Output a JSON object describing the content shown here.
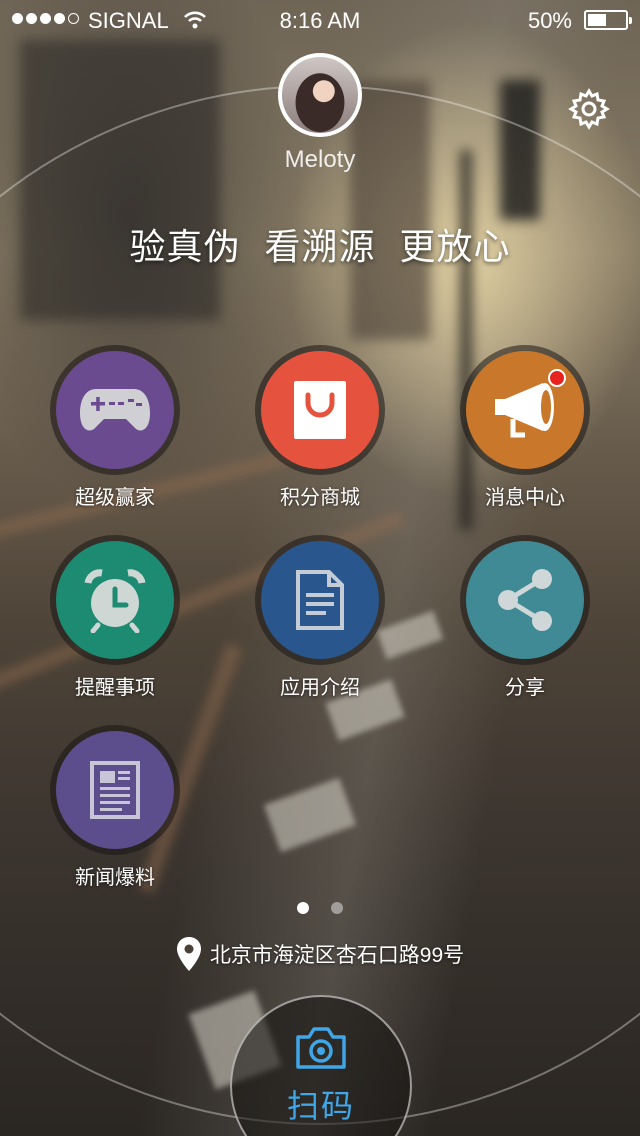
{
  "status_bar": {
    "signal_bars_filled": 4,
    "signal_bars_total": 5,
    "carrier": "SIGNAL",
    "time": "8:16 AM",
    "battery_percent_text": "50%",
    "battery_level": 0.5
  },
  "profile": {
    "username": "Meloty",
    "avatar_icon": "user-avatar"
  },
  "settings_icon": "gear-icon",
  "slogan": [
    "验真伪",
    "看溯源",
    "更放心"
  ],
  "grid": [
    {
      "label": "超级赢家",
      "icon": "gamepad-icon",
      "color": "#6b4b8f"
    },
    {
      "label": "积分商城",
      "icon": "shopping-bag-icon",
      "color": "#e5533f"
    },
    {
      "label": "消息中心",
      "icon": "megaphone-icon",
      "color": "#c9782b",
      "badge": true
    },
    {
      "label": "提醒事项",
      "icon": "alarm-clock-icon",
      "color": "#1d8a72"
    },
    {
      "label": "应用介绍",
      "icon": "document-icon",
      "color": "#28568d"
    },
    {
      "label": "分享",
      "icon": "share-icon",
      "color": "#3f8a95"
    },
    {
      "label": "新闻爆料",
      "icon": "newspaper-icon",
      "color": "#5c4e8c"
    }
  ],
  "pager": {
    "pages": 2,
    "active": 1
  },
  "location": {
    "icon": "location-pin-icon",
    "text": "北京市海淀区杏石口路99号"
  },
  "scan": {
    "icon": "camera-icon",
    "label": "扫码",
    "color": "#3fa6e8"
  }
}
